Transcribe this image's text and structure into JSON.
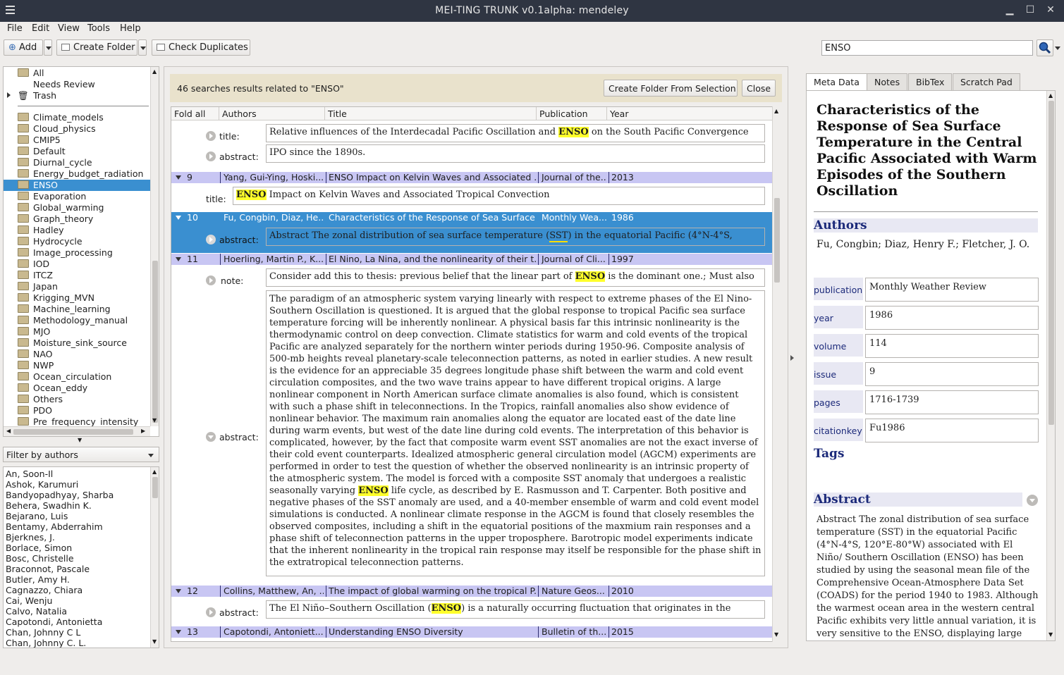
{
  "window": {
    "title": "MEI-TING TRUNK v0.1alpha: mendeley"
  },
  "menu": [
    "File",
    "Edit",
    "View",
    "Tools",
    "Help"
  ],
  "toolbar": {
    "add": "Add",
    "create_folder": "Create Folder",
    "check_duplicates": "Check Duplicates",
    "search_value": "ENSO"
  },
  "folders": {
    "top": [
      "All",
      "Needs Review",
      "Trash"
    ],
    "items": [
      "Climate_models",
      "Cloud_physics",
      "CMIP5",
      "Default",
      "Diurnal_cycle",
      "Energy_budget_radiation",
      "ENSO",
      "Evaporation",
      "Global_warming",
      "Graph_theory",
      "Hadley",
      "Hydrocycle",
      "Image_processing",
      "IOD",
      "ITCZ",
      "Japan",
      "Krigging_MVN",
      "Machine_learning",
      "Methodology_manual",
      "MJO",
      "Moisture_sink_source",
      "NAO",
      "NWP",
      "Ocean_circulation",
      "Ocean_eddy",
      "Others",
      "PDO",
      "Pre_frequency_intensity"
    ],
    "selected": "ENSO"
  },
  "filter": {
    "label": "Filter by authors"
  },
  "authors": [
    "An, Soon-Il",
    "Ashok, Karumuri",
    "Bandyopadhyay, Sharba",
    "Behera, Swadhin K.",
    "Bejarano, Luis",
    "Bentamy, Abderrahim",
    "Bjerknes, J.",
    "Borlace, Simon",
    "Bosc, Christelle",
    "Braconnot, Pascale",
    "Butler, Amy H.",
    "Cagnazzo, Chiara",
    "Cai, Wenju",
    "Calvo, Natalia",
    "Capotondi, Antonietta",
    "Chan, Johnny C L",
    "Chan, Johnny C. L."
  ],
  "results": {
    "banner": "46 searches results related to \"ENSO\"",
    "create_folder_btn": "Create Folder From Selection",
    "close_btn": "Close",
    "headers": {
      "fold": "Fold all",
      "authors": "Authors",
      "title": "Title",
      "publication": "Publication",
      "year": "Year"
    },
    "field_labels": {
      "title": "title:",
      "abstract": "abstract:",
      "note": "note:"
    },
    "rec0_title_pre": "Relative influences of the Interdecadal Pacific Oscillation and ",
    "rec0_title_post": " on the South Pacific Convergence",
    "rec0_abstract": "IPO since the 1890s.",
    "rec9": {
      "num": "9",
      "authors": "Yang, Gui-Ying, Hoski...",
      "title": "ENSO Impact on Kelvin Waves and Associated ...",
      "pub": "Journal of the...",
      "year": "2013"
    },
    "rec9_title_post": " Impact on Kelvin Waves and Associated Tropical Convection",
    "rec10": {
      "num": "10",
      "authors": "Fu, Congbin, Diaz, He...",
      "title": "Characteristics of the Response of Sea Surface...",
      "pub": "Monthly Wea...",
      "year": "1986"
    },
    "rec10_abstract_pre": "Abstract The zonal distribution of sea surface temperature (",
    "rec10_abstract_sst": "SST",
    "rec10_abstract_post": ") in the equatorial Pacific (4°N-4°S,",
    "rec11": {
      "num": "11",
      "authors": "Hoerling, Martin P., K...",
      "title": "El Nino, La Nina, and the nonlinearity of their t...",
      "pub": "Journal of Cli...",
      "year": "1997"
    },
    "rec11_note_pre": "Consider add this to thesis: previous belief that the linear part of ",
    "rec11_note_post": " is the dominant one.; Must also",
    "rec11_abstract_pre": "The paradigm of an atmospheric system varying linearly with respect to extreme phases of the El Nino-Southern Oscillation is questioned. It is argued that the global response to tropical Pacific sea surface temperature forcing will be inherently nonlinear. A physical basis far this intrinsic nonlinearity is the thermodynamic control on deep convection. Climate statistics for warm and cold events of the tropical Pacific are analyzed separately for the northern winter periods during 1950-96. Composite analysis of 500-mb heights reveal planetary-scale teleconnection patterns, as noted in earlier studies. A new result is the evidence for an appreciable 35 degrees longitude phase shift between the warm and cold event circulation composites, and the two wave trains appear to have different tropical origins. A large nonlinear component in North American surface climate anomalies is also found, which is consistent with such a phase shift in teleconnections. In the Tropics, rainfall anomalies also show evidence of nonlinear behavior. The maximum rain anomalies along the equator are located east of the date line during warm events, but west of the date line during cold events. The interpretation of this behavior is complicated, however, by the fact that composite warm event SST anomalies are not the exact inverse of their cold event counterparts. Idealized atmospheric general circulation model (AGCM) experiments are performed in order to test the question of whether the observed nonlinearity is an intrinsic property of the atmospheric system. The model is forced with a composite SST anomaly that undergoes a realistic seasonally varying ",
    "rec11_abstract_post": " life cycle, as described by E. Rasmusson and T. Carpenter. Both positive and negative phases of the SST anomaly are used, and a 40-member ensemble of warm and cold event model simulations is conducted. A nonlinear climate response in the AGCM is found that closely resembles the observed composites, including a shift in the equatorial positions of the maxmium rain responses and a phase shift of teleconnection patterns in the upper troposphere. Barotropic model experiments indicate that the inherent nonlinearity in the tropical rain response may itself be responsible for the phase shift in the extratropical teleconnection patterns.",
    "rec12": {
      "num": "12",
      "authors": "Collins, Matthew, An, ...",
      "title": "The impact of global warming on the tropical P...",
      "pub": "Nature Geos...",
      "year": "2010"
    },
    "rec12_abstract_pre": "The El Niño–Southern Oscillation (",
    "rec12_abstract_post": ") is a naturally occurring fluctuation that originates in the",
    "rec13": {
      "num": "13",
      "authors": "Capotondi, Antoniett...",
      "title": "Understanding ENSO Diversity",
      "pub": "Bulletin of th...",
      "year": "2015"
    },
    "hl": "ENSO"
  },
  "tabs": [
    "Meta Data",
    "Notes",
    "BibTex",
    "Scratch Pad"
  ],
  "meta": {
    "title": "Characteristics of the Response of Sea Surface Temperature in the Central Pacific Associated with Warm Episodes of the Southern Oscillation",
    "authors_heading": "Authors",
    "authors": "Fu, Congbin; Diaz, Henry F.; Fletcher, J. O.",
    "fields": [
      {
        "label": "publication",
        "value": "Monthly Weather Review"
      },
      {
        "label": "year",
        "value": "1986"
      },
      {
        "label": "volume",
        "value": "114"
      },
      {
        "label": "issue",
        "value": "9"
      },
      {
        "label": "pages",
        "value": "1716-1739"
      },
      {
        "label": "citationkey",
        "value": "Fu1986"
      }
    ],
    "tags_heading": "Tags",
    "abstract_heading": "Abstract",
    "abstract": "Abstract The zonal distribution of sea surface temperature (SST) in the equatorial Pacific (4°N-4°S, 120°E-80°W) associated with El Niño/ Southern Oscillation (ENSO) has been studied by using the seasonal mean file of the Comprehensive Ocean-Atmosphere Data Set (COADS) for the period 1940 to 1983. Although the warmest ocean area in the western central Pacific exhibits very little annual variation, it is very sensitive to the ENSO, displaying large variability during such"
  }
}
